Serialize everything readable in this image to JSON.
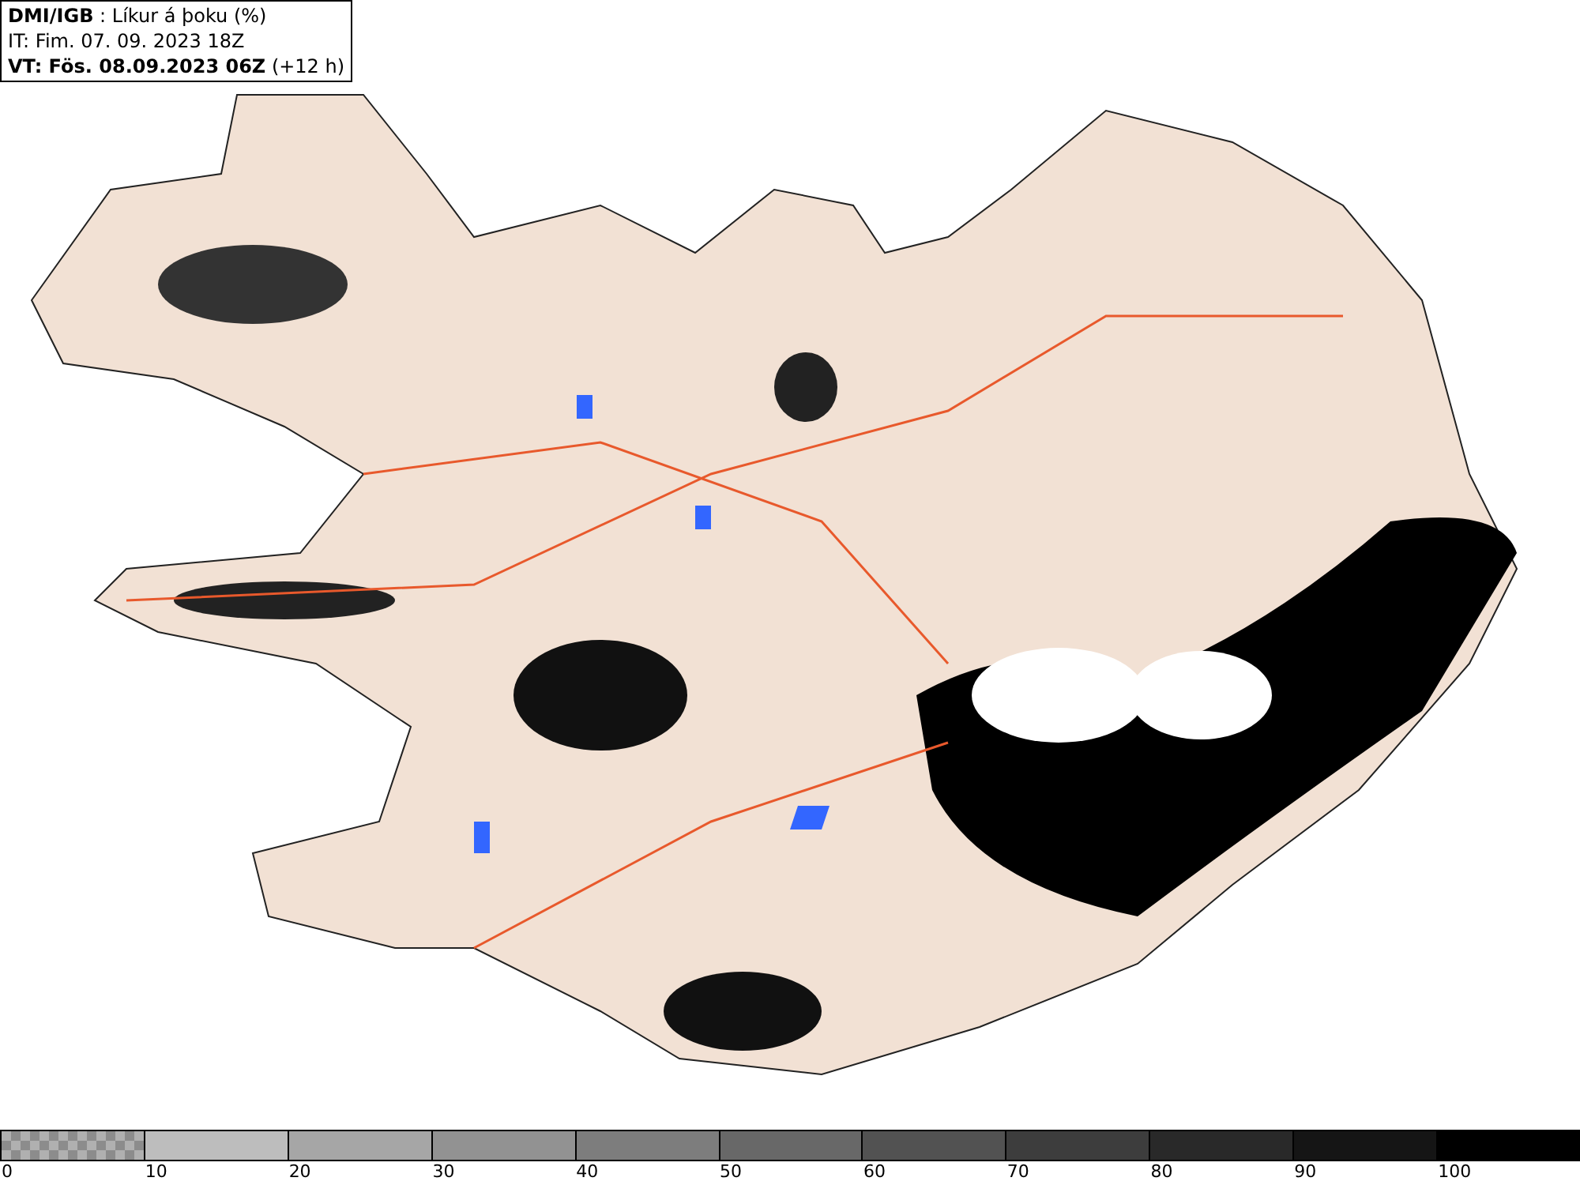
{
  "header": {
    "lines": [
      "**DMI/IGB** : Líkur á þoku (%)",
      "IT: Fim. 07. 09. 2023 18Z",
      "**VT: Fös. 08.09.2023 06Z** (+12 h)"
    ]
  },
  "legend": {
    "items": [
      {
        "label": "0",
        "kind": "checker",
        "color": "#8c8c8c"
      },
      {
        "label": "10",
        "kind": "solid",
        "color": "#bdbdbd"
      },
      {
        "label": "20",
        "kind": "solid",
        "color": "#a6a6a6"
      },
      {
        "label": "30",
        "kind": "solid",
        "color": "#929292"
      },
      {
        "label": "40",
        "kind": "solid",
        "color": "#7d7d7d"
      },
      {
        "label": "50",
        "kind": "solid",
        "color": "#686868"
      },
      {
        "label": "60",
        "kind": "solid",
        "color": "#525252"
      },
      {
        "label": "70",
        "kind": "solid",
        "color": "#3d3d3d"
      },
      {
        "label": "80",
        "kind": "solid",
        "color": "#292929"
      },
      {
        "label": "90",
        "kind": "solid",
        "color": "#151515"
      },
      {
        "label": "100",
        "kind": "solid",
        "color": "#000000"
      }
    ]
  }
}
